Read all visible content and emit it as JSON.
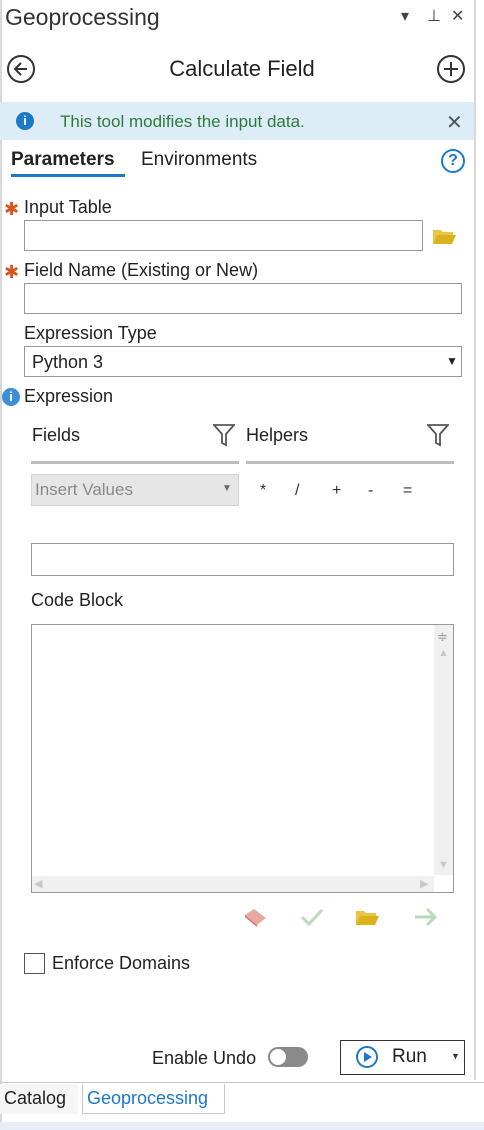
{
  "window": {
    "title": "Geoprocessing",
    "controls": {
      "menu": "▾",
      "pin": "⊥",
      "close": "✕"
    }
  },
  "tool": {
    "title": "Calculate Field"
  },
  "banner": {
    "text": "This tool modifies the input data."
  },
  "tabs": [
    {
      "label": "Parameters",
      "active": true
    },
    {
      "label": "Environments",
      "active": false
    }
  ],
  "params": {
    "input_table": {
      "label": "Input Table",
      "value": ""
    },
    "field_name": {
      "label": "Field Name (Existing or New)",
      "value": ""
    },
    "expression_type": {
      "label": "Expression Type",
      "value": "Python 3"
    },
    "expression": {
      "label": "Expression",
      "fields_label": "Fields",
      "helpers_label": "Helpers",
      "insert_values": "Insert Values",
      "operators": [
        "*",
        "/",
        "+",
        "-",
        "="
      ],
      "value": ""
    },
    "code_block": {
      "label": "Code Block",
      "value": ""
    },
    "enforce_domains": {
      "label": "Enforce Domains",
      "checked": false
    }
  },
  "footer": {
    "enable_undo_label": "Enable Undo",
    "run_label": "Run"
  },
  "bottom_tabs": [
    {
      "label": "Catalog",
      "active": false
    },
    {
      "label": "Geoprocessing",
      "active": true
    }
  ],
  "colors": {
    "accent": "#1e78c8",
    "banner_bg": "#dcedf8",
    "banner_text": "#2f7a3a",
    "required": "#d9531e",
    "folder": "#d9b21c"
  }
}
